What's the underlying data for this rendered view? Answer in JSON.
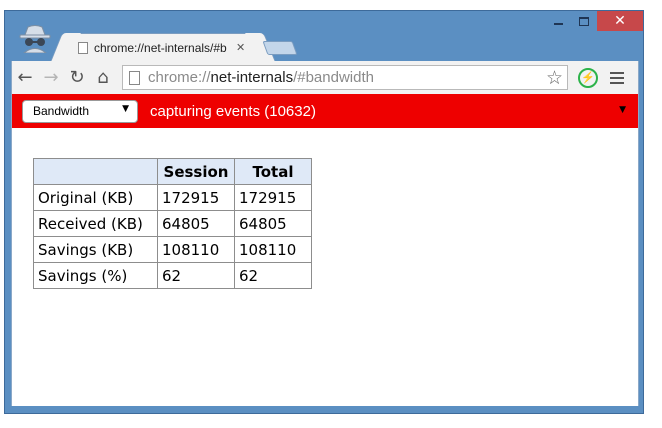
{
  "window": {
    "minimize_icon": "minimize-icon",
    "maximize_icon": "maximize-icon",
    "close_glyph": "✕"
  },
  "tab": {
    "title": "chrome://net-internals/#b",
    "close_glyph": "✕"
  },
  "toolbar": {
    "back_glyph": "←",
    "forward_glyph": "→",
    "reload_glyph": "↻",
    "home_glyph": "⌂",
    "url_scheme": "chrome://",
    "url_host": "net-internals",
    "url_path": "/#bandwidth",
    "star_glyph": "☆",
    "extension_glyph": "⚡"
  },
  "status_bar": {
    "view_selected": "Bandwidth",
    "view_arrow": "▼",
    "status_text": "capturing events (10632)",
    "status_arrow": "▼",
    "color": "#ee0000"
  },
  "bandwidth_table": {
    "headers": [
      "",
      "Session",
      "Total"
    ],
    "rows": [
      [
        "Original (KB)",
        "172915",
        "172915"
      ],
      [
        "Received (KB)",
        "64805",
        "64805"
      ],
      [
        "Savings (KB)",
        "108110",
        "108110"
      ],
      [
        "Savings (%)",
        "62",
        "62"
      ]
    ]
  }
}
